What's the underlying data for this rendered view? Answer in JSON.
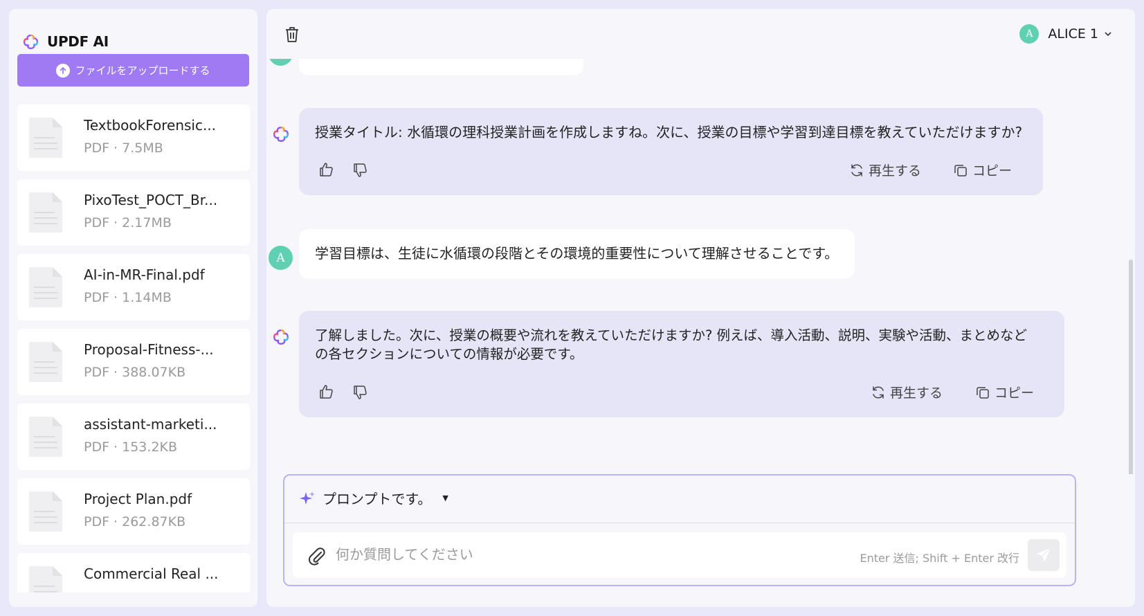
{
  "sidebar": {
    "brand": "UPDF AI",
    "upload_label": "ファイルをアップロードする",
    "files": [
      {
        "name": "TextbookForensic...",
        "meta": "PDF · 7.5MB"
      },
      {
        "name": "PixoTest_POCT_Br...",
        "meta": "PDF · 2.17MB"
      },
      {
        "name": "AI-in-MR-Final.pdf",
        "meta": "PDF · 1.14MB"
      },
      {
        "name": "Proposal-Fitness-...",
        "meta": "PDF · 388.07KB"
      },
      {
        "name": "assistant-marketi...",
        "meta": "PDF · 153.2KB"
      },
      {
        "name": "Project Plan.pdf",
        "meta": "PDF · 262.87KB"
      },
      {
        "name": "Commercial Real ...",
        "meta": ""
      }
    ]
  },
  "header": {
    "user_initial": "A",
    "user_name": "ALICE 1"
  },
  "chat": {
    "messages": [
      {
        "role": "ai",
        "text": "授業タイトル: 水循環の理科授業計画を作成しますね。次に、授業の目標や学習到達目標を教えていただけますか?"
      },
      {
        "role": "user",
        "text": "学習目標は、生徒に水循環の段階とその環境的重要性について理解させることです。"
      },
      {
        "role": "ai",
        "text_line1": "了解しました。次に、授業の概要や流れを教えていただけますか? 例えば、導入活動、説明、実験や活動、まとめなど",
        "text_line2": "の各セクションについての情報が必要です。"
      }
    ],
    "regenerate_label": "再生する",
    "copy_label": "コピー"
  },
  "composer": {
    "prompt_label": "プロンプトです。",
    "placeholder": "何か質問してください",
    "hint": "Enter 送信; Shift + Enter 改行"
  },
  "colors": {
    "accent": "#a07af2",
    "ai_bubble": "#e6e5f8",
    "avatar": "#5fd1b2"
  }
}
